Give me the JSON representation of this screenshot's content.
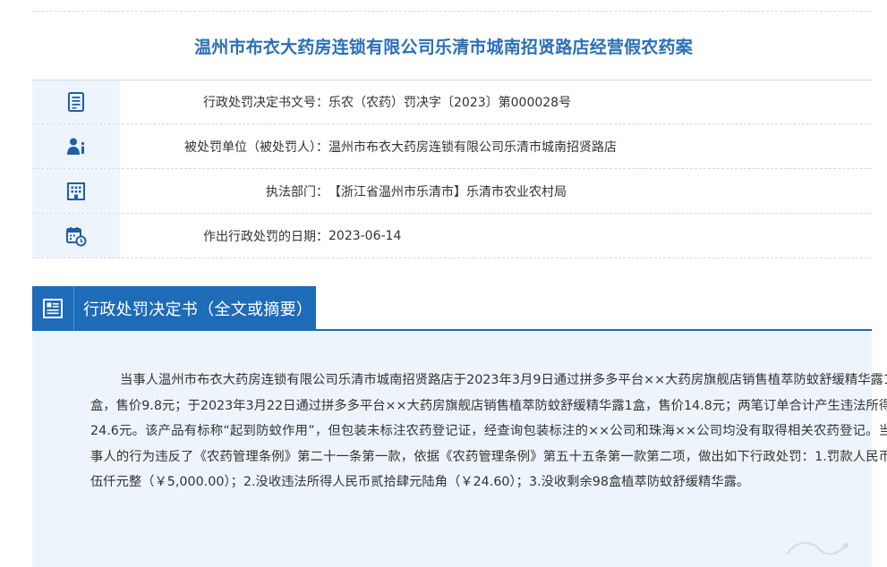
{
  "page_title": "温州市布衣大药房连锁有限公司乐清市城南招贤路店经营假农药案",
  "info_rows": [
    {
      "icon": "document-list-icon",
      "label": "行政处罚决定书文号：",
      "value": "乐农（农药）罚决字〔2023〕第000028号"
    },
    {
      "icon": "person-info-icon",
      "label": "被处罚单位（被处罚人）：",
      "value": "温州市布衣大药房连锁有限公司乐清市城南招贤路店"
    },
    {
      "icon": "building-icon",
      "label": "执法部门：",
      "value": "【浙江省温州市乐清市】乐清市农业农村局"
    },
    {
      "icon": "calendar-clock-icon",
      "label": "作出行政处罚的日期：",
      "value": "2023-06-14"
    }
  ],
  "section": {
    "icon": "document-text-icon",
    "title": "行政处罚决定书（全文或摘要）"
  },
  "content": {
    "body": "当事人温州市布衣大药房连锁有限公司乐清市城南招贤路店于2023年3月9日通过拼多多平台××大药房旗舰店销售植萃防蚊舒缓精华露1盒，售价9.8元；于2023年3月22日通过拼多多平台××大药房旗舰店销售植萃防蚊舒缓精华露1盒，售价14.8元；两笔订单合计产生违法所得24.6元。该产品有标称“起到防蚊作用”，但包装未标注农药登记证，经查询包装标注的××公司和珠海××公司均没有取得相关农药登记。当事人的行为违反了《农药管理条例》第二十一条第一款，依据《农药管理条例》第五十五条第一款第二项，做出如下行政处罚：1.罚款人民币伍仟元整（￥5,000.00）；2.没收违法所得人民币贰拾肆元陆角（￥24.60）；3.没收剩余98盒植萃防蚊舒缓精华露。"
  },
  "colors": {
    "accent": "#1e6bb8",
    "title": "#2a6fb5",
    "panel": "#eef4fb"
  }
}
